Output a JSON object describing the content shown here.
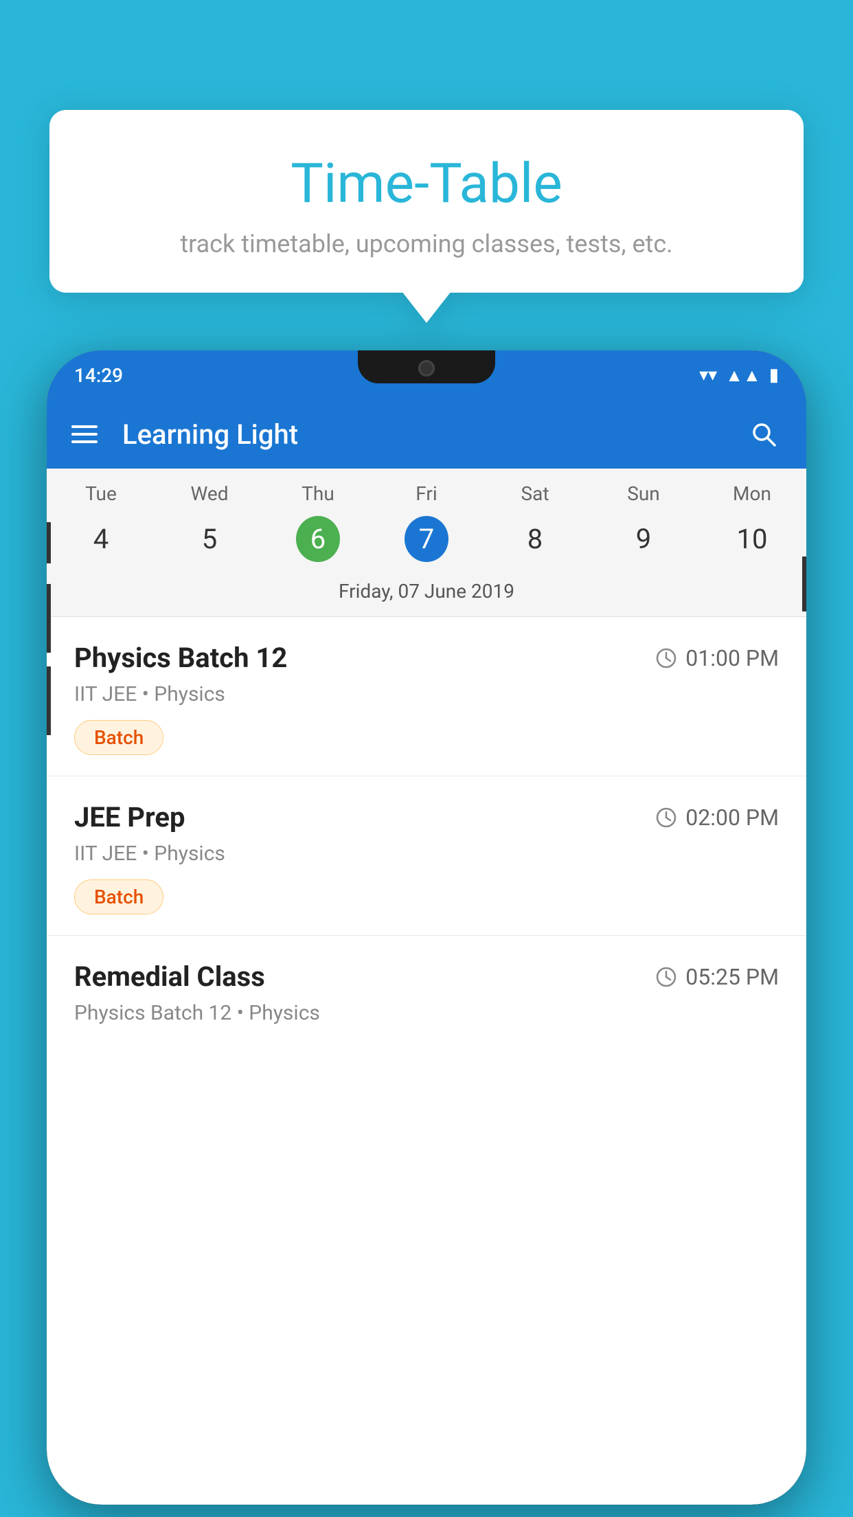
{
  "background_color": "#29b6d8",
  "tooltip": {
    "title": "Time-Table",
    "subtitle": "track timetable, upcoming classes, tests, etc."
  },
  "status_bar": {
    "time": "14:29"
  },
  "app_bar": {
    "title": "Learning Light",
    "search_label": "search"
  },
  "calendar": {
    "days": [
      {
        "label": "Tue",
        "number": "4"
      },
      {
        "label": "Wed",
        "number": "5"
      },
      {
        "label": "Thu",
        "number": "6",
        "today": true
      },
      {
        "label": "Fri",
        "number": "7",
        "selected": true
      },
      {
        "label": "Sat",
        "number": "8"
      },
      {
        "label": "Sun",
        "number": "9"
      },
      {
        "label": "Mon",
        "number": "10"
      }
    ],
    "selected_date_label": "Friday, 07 June 2019"
  },
  "schedule": {
    "items": [
      {
        "name": "Physics Batch 12",
        "time": "01:00 PM",
        "subject": "IIT JEE • Physics",
        "badge": "Batch"
      },
      {
        "name": "JEE Prep",
        "time": "02:00 PM",
        "subject": "IIT JEE • Physics",
        "badge": "Batch"
      },
      {
        "name": "Remedial Class",
        "time": "05:25 PM",
        "subject": "Physics Batch 12 • Physics",
        "badge": null
      }
    ]
  }
}
